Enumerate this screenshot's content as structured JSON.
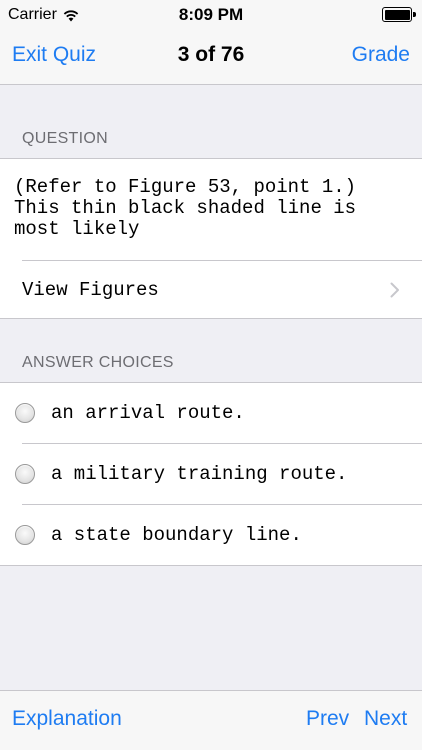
{
  "status_bar": {
    "carrier": "Carrier",
    "time": "8:09 PM"
  },
  "nav": {
    "left": "Exit Quiz",
    "title": "3 of 76",
    "right": "Grade"
  },
  "question": {
    "section_title": "QUESTION",
    "text": "(Refer to Figure 53, point 1.)\nThis thin black shaded line is\nmost likely",
    "view_figures": "View Figures"
  },
  "answers": {
    "section_title": "ANSWER CHOICES",
    "choices": [
      "an arrival route.",
      "a military training route.",
      "a state boundary line."
    ]
  },
  "toolbar": {
    "explanation": "Explanation",
    "prev": "Prev",
    "next": "Next"
  },
  "colors": {
    "accent": "#1e7cf2",
    "background": "#efeff4",
    "bar": "#f7f7f7",
    "separator": "#c8c7cc",
    "section_text": "#6d6d72"
  },
  "icons": [
    "wifi-icon",
    "battery-icon",
    "chevron-right-icon",
    "radio-button-icon"
  ]
}
